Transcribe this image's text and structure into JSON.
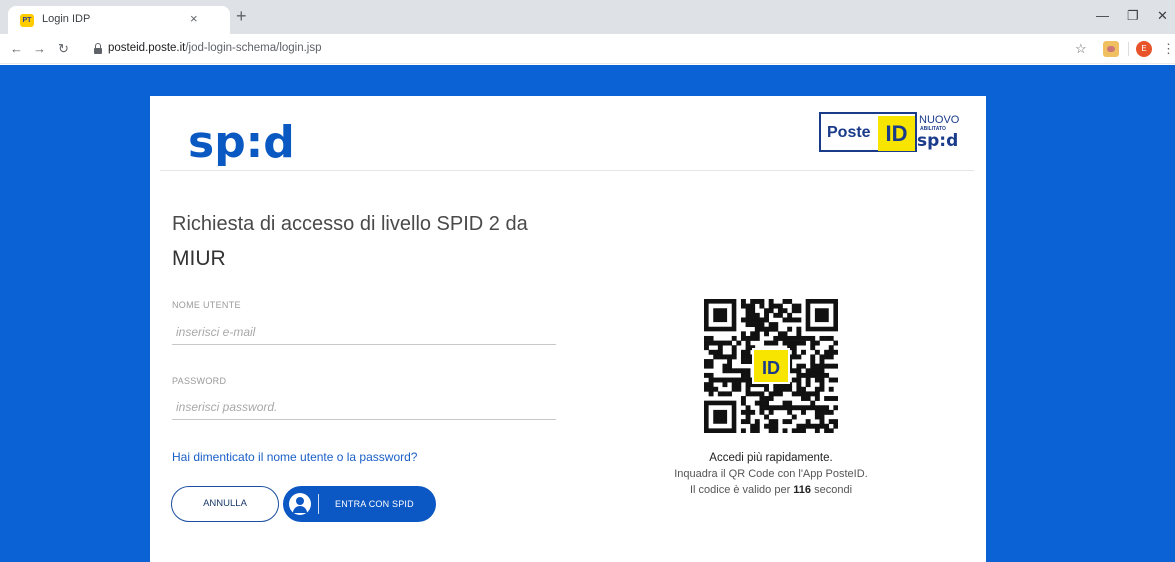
{
  "browser": {
    "tab_title": "Login IDP",
    "favicon_text": "PT",
    "tab_close": "×",
    "new_tab": "+",
    "url_host": "posteid.poste.it",
    "url_path": "/jod-login-schema/login.jsp",
    "profile_initial": "E",
    "icons": [
      "back-arrow-icon",
      "forward-arrow-icon",
      "reload-icon",
      "lock-icon",
      "star-icon",
      "extension-icon",
      "menu-dots-icon",
      "minimize-icon",
      "restore-icon",
      "close-icon"
    ]
  },
  "header": {
    "spid_logo": "sp:d",
    "poste_word": "Poste",
    "poste_id": "ID",
    "nuovo": "NUOVO",
    "abilitato": "ABILITATO",
    "spid_small": "sp:d"
  },
  "form": {
    "request_text": "Richiesta di accesso di livello SPID 2 da",
    "provider": "MIUR",
    "username_label": "NOME UTENTE",
    "username_placeholder": "inserisci e-mail",
    "password_label": "PASSWORD",
    "password_placeholder": "inserisci password.",
    "forgot_link": "Hai dimenticato il nome utente o la password?",
    "cancel_label": "ANNULLA",
    "enter_label": "ENTRA CON SPID"
  },
  "qr": {
    "center_label": "ID",
    "title": "Accedi più rapidamente.",
    "description": "Inquadra il QR Code con l'App PosteID.",
    "timer_prefix": "Il codice è valido per ",
    "timer_seconds": "116",
    "timer_suffix": " secondi"
  },
  "colors": {
    "page_background": "#0b62d4",
    "spid_blue": "#0a58c2",
    "poste_yellow": "#f7e500",
    "poste_navy": "#1a3a8a",
    "button_blue": "#0b57c4",
    "link_blue": "#1a5fc7"
  }
}
